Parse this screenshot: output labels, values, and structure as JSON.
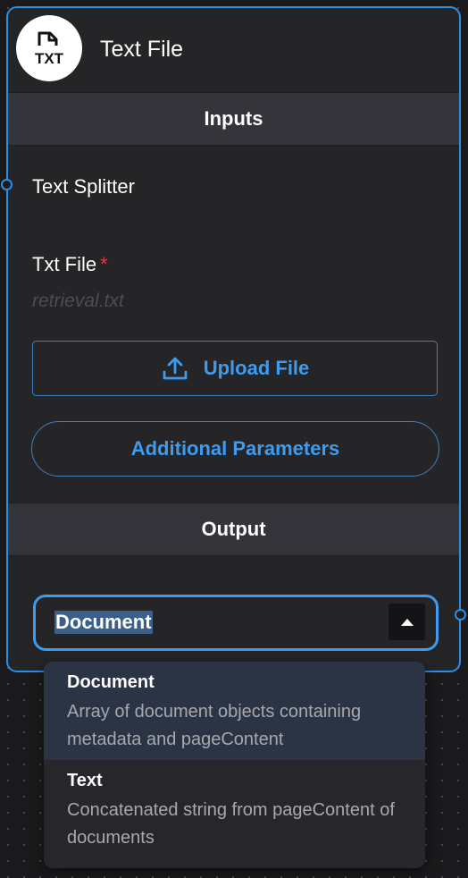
{
  "node": {
    "title": "Text File",
    "icon": "txt-file-icon",
    "icon_label": "TXT"
  },
  "inputs": {
    "section_label": "Inputs",
    "text_splitter_label": "Text Splitter",
    "txt_file_label": "Txt File",
    "required_marker": "*",
    "file_value": "retrieval.txt",
    "upload_button_label": "Upload File",
    "additional_params_label": "Additional Parameters"
  },
  "output": {
    "section_label": "Output",
    "selected_value": "Document",
    "options": [
      {
        "title": "Document",
        "description": "Array of document objects containing metadata and pageContent",
        "selected": true
      },
      {
        "title": "Text",
        "description": "Concatenated string from pageContent of documents",
        "selected": false
      }
    ]
  },
  "colors": {
    "accent": "#3d9bf0",
    "node_border": "#2b8de3",
    "node_bg": "#252528",
    "section_bg": "#34343a",
    "required": "#e53935",
    "placeholder": "#4c4c52"
  }
}
